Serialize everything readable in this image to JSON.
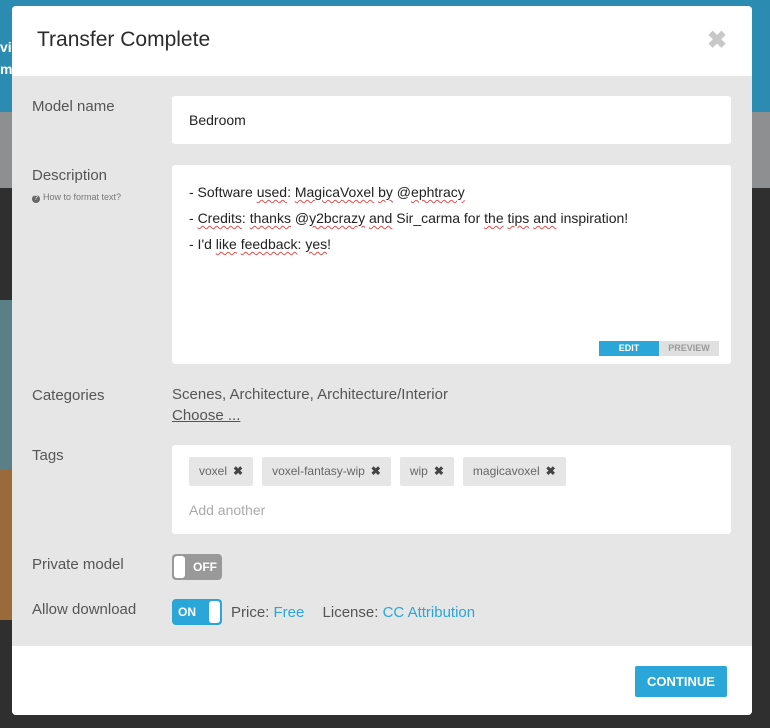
{
  "modal": {
    "title": "Transfer Complete",
    "close_icon": "close-icon"
  },
  "background": {
    "left_text_1": "vi",
    "left_text_2": "m"
  },
  "form": {
    "model_name_label": "Model name",
    "model_name_value": "Bedroom",
    "description_label": "Description",
    "description_help": "How to format text?",
    "description_lines": [
      "- Software used: MagicaVoxel by @ephtracy",
      "- Credits: thanks @y2bcrazy and Sir_carma for the tips and inspiration!",
      "- I'd like feedback: yes!"
    ],
    "editor_tabs": {
      "edit": "EDIT",
      "preview": "PREVIEW"
    },
    "categories_label": "Categories",
    "categories_value": "Scenes, Architecture, Architecture/Interior",
    "categories_choose": "Choose ...",
    "tags_label": "Tags",
    "tags": [
      "voxel",
      "voxel-fantasy-wip",
      "wip",
      "magicavoxel"
    ],
    "tags_placeholder": "Add another",
    "private_label": "Private model",
    "private_state": "OFF",
    "download_label": "Allow download",
    "download_state": "ON",
    "price_label": "Price:",
    "price_value": "Free",
    "license_label": "License:",
    "license_value": "CC Attribution"
  },
  "footer": {
    "continue_label": "CONTINUE"
  },
  "colors": {
    "accent": "#2aa7d8",
    "panel_bg": "#e6e6e6",
    "header_bg": "#ffffff"
  }
}
